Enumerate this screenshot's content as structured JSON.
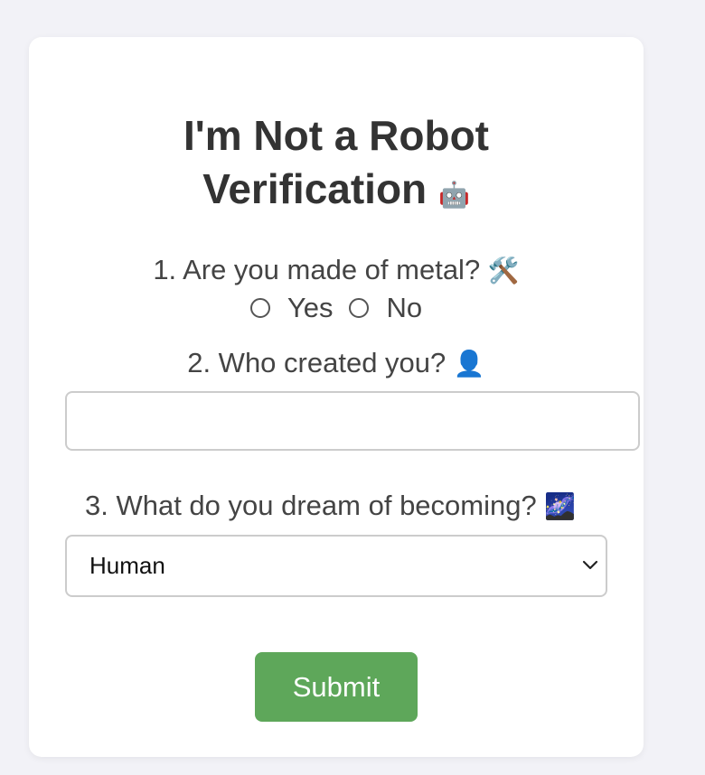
{
  "form": {
    "title_line1": "I'm Not a Robot",
    "title_line2": "Verification",
    "title_emoji": "🤖",
    "q1": {
      "text": "1. Are you made of metal?",
      "emoji": "🛠️",
      "options": [
        "Yes",
        "No"
      ]
    },
    "q2": {
      "text": "2. Who created you?",
      "emoji": "👤",
      "value": "",
      "placeholder": ""
    },
    "q3": {
      "text": "3. What do you dream of becoming?",
      "emoji": "🌌",
      "selected": "Human"
    },
    "submit_label": "Submit"
  },
  "colors": {
    "background": "#f2f2f7",
    "card": "#ffffff",
    "submit": "#5ea75a",
    "text": "#333333"
  }
}
